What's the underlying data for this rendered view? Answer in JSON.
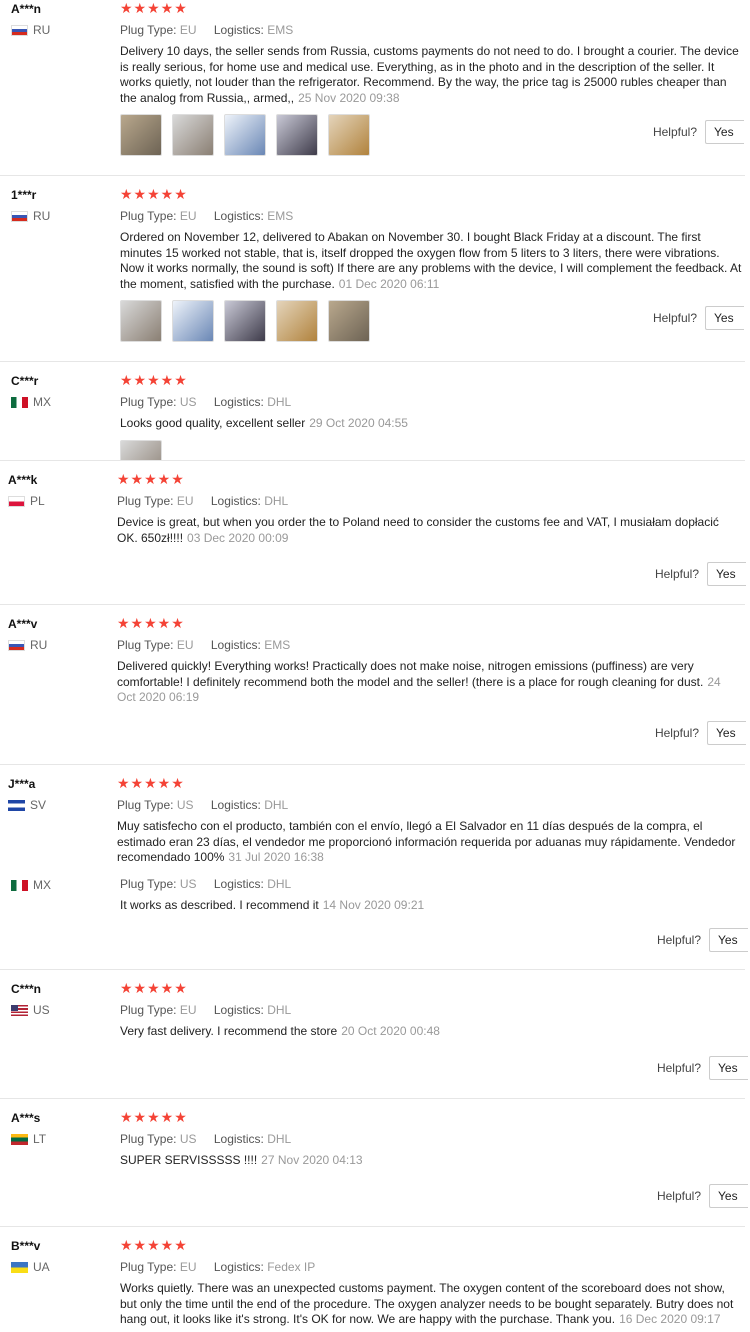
{
  "labels": {
    "plug": "Plug Type:",
    "logistics": "Logistics:",
    "helpful": "Helpful?",
    "yes": "Yes"
  },
  "reviews": [
    {
      "user": "A***n",
      "country": "RU",
      "stars": "★★★★★",
      "plug": "EU",
      "logistics": "EMS",
      "text": "Delivery 10 days, the seller sends from Russia, customs payments do not need to do. I brought a courier. The device is really serious, for home use and medical use. Everything, as in the photo and in the description of the seller. It works quietly, not louder than the refrigerator. Recommend. By the way, the price tag is 25000 rubles cheaper than the analog from Russia,, armed,,",
      "date": "25 Nov 2020 09:38"
    },
    {
      "user": "1***r",
      "country": "RU",
      "stars": "★★★★★",
      "plug": "EU",
      "logistics": "EMS",
      "text": "Ordered on November 12, delivered to Abakan on November 30. I bought Black Friday at a discount. The first minutes 15 worked not stable, that is, itself dropped the oxygen flow from 5 liters to 3 liters, there were vibrations. Now it works normally, the sound is soft) If there are any problems with the device, I will complement the feedback. At the moment, satisfied with the purchase.",
      "date": "01 Dec 2020 06:11"
    },
    {
      "user": "C***r",
      "country": "MX",
      "stars": "★★★★★",
      "plug": "US",
      "logistics": "DHL",
      "text": "Looks good quality, excellent seller",
      "date": "29 Oct 2020 04:55"
    },
    {
      "user": "A***k",
      "country": "PL",
      "stars": "★★★★★",
      "plug": "EU",
      "logistics": "DHL",
      "text": "Device is great, but when you order the to Poland need to consider the customs fee and VAT, I musiałam dopłacić OK. 650zł!!!!",
      "date": "03 Dec 2020 00:09"
    },
    {
      "user": "A***v",
      "country": "RU",
      "stars": "★★★★★",
      "plug": "EU",
      "logistics": "EMS",
      "text": "Delivered quickly! Everything works! Practically does not make noise, nitrogen emissions (puffiness) are very comfortable! I definitely recommend both the model and the seller! (there is a place for rough cleaning for dust.",
      "date": "24 Oct 2020 06:19"
    },
    {
      "user": "J***a",
      "country": "SV",
      "stars": "★★★★★",
      "plug": "US",
      "logistics": "DHL",
      "text": "Muy satisfecho con el producto, también con el envío, llegó a El Salvador en 11 días después de la compra, el estimado eran 23 días, el vendedor me proporcionó información requerida por aduanas muy rápidamente. Vendedor recomendado 100%",
      "date": "31 Jul 2020 16:38"
    },
    {
      "user": "",
      "country": "MX",
      "stars": "",
      "plug": "US",
      "logistics": "DHL",
      "text": "It works as described. I recommend it",
      "date": "14 Nov 2020 09:21"
    },
    {
      "user": "C***n",
      "country": "US",
      "stars": "★★★★★",
      "plug": "EU",
      "logistics": "DHL",
      "text": "Very fast delivery. I recommend the store",
      "date": "20 Oct 2020 00:48"
    },
    {
      "user": "A***s",
      "country": "LT",
      "stars": "★★★★★",
      "plug": "US",
      "logistics": "DHL",
      "text": "SUPER SERVISSSSS !!!!",
      "date": "27 Nov 2020 04:13"
    },
    {
      "user": "B***v",
      "country": "UA",
      "stars": "★★★★★",
      "plug": "EU",
      "logistics": "Fedex IP",
      "text": "Works quietly. There was an unexpected customs payment. The oxygen content of the scoreboard does not show, but only the time until the end of the procedure. The oxygen analyzer needs to be bought separately. Butry does not hang out, it looks like it's strong. It's OK for now. We are happy with the purchase. Thank you.",
      "date": "16 Dec 2020 09:17"
    }
  ]
}
